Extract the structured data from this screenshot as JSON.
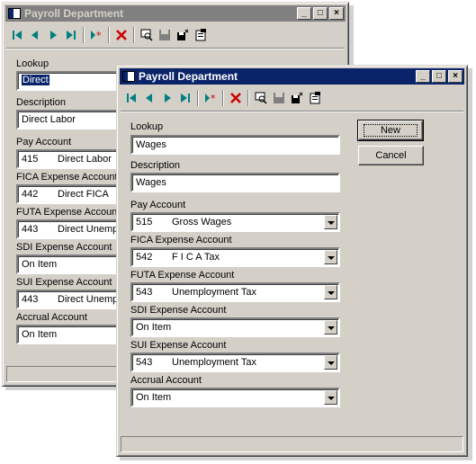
{
  "back_window": {
    "title": "Payroll Department",
    "fields": [
      {
        "label": "Lookup",
        "value": "Direct",
        "selected": true
      },
      {
        "label": "Description",
        "value": "Direct Labor"
      },
      {
        "label": "Pay Account",
        "code": "415",
        "name": "Direct Labor"
      },
      {
        "label": "FICA Expense Account",
        "code": "442",
        "name": "Direct FICA"
      },
      {
        "label": "FUTA Expense Account",
        "code": "443",
        "name": "Direct Unemploy"
      },
      {
        "label": "SDI Expense Account",
        "value": "On Item"
      },
      {
        "label": "SUI Expense Account",
        "code": "443",
        "name": "Direct Unemploy"
      },
      {
        "label": "Accrual Account",
        "value": "On Item"
      }
    ]
  },
  "front_window": {
    "title": "Payroll Department",
    "fields": [
      {
        "label": "Lookup",
        "value": "Wages"
      },
      {
        "label": "Description",
        "value": "Wages"
      },
      {
        "label": "Pay Account",
        "code": "515",
        "name": "Gross Wages"
      },
      {
        "label": "FICA Expense Account",
        "code": "542",
        "name": "F I C A Tax"
      },
      {
        "label": "FUTA Expense Account",
        "code": "543",
        "name": "Unemployment Tax"
      },
      {
        "label": "SDI Expense Account",
        "value": "On Item"
      },
      {
        "label": "SUI Expense Account",
        "code": "543",
        "name": "Unemployment Tax"
      },
      {
        "label": "Accrual Account",
        "value": "On Item"
      }
    ],
    "buttons": {
      "new": "New",
      "cancel": "Cancel"
    }
  },
  "title_buttons": {
    "minimize": "_",
    "maximize": "□",
    "close": "×"
  },
  "toolbar_icons": [
    "first-record-icon",
    "previous-record-icon",
    "next-record-icon",
    "last-record-icon",
    "new-record-icon",
    "delete-record-icon",
    "find-icon",
    "save-icon",
    "save-close-icon",
    "properties-icon"
  ],
  "colors": {
    "active_title": "#0a246a",
    "inactive_title": "#808080",
    "face": "#d4d0c8",
    "nav_green": "#008080",
    "delete_red": "#cc0000"
  }
}
